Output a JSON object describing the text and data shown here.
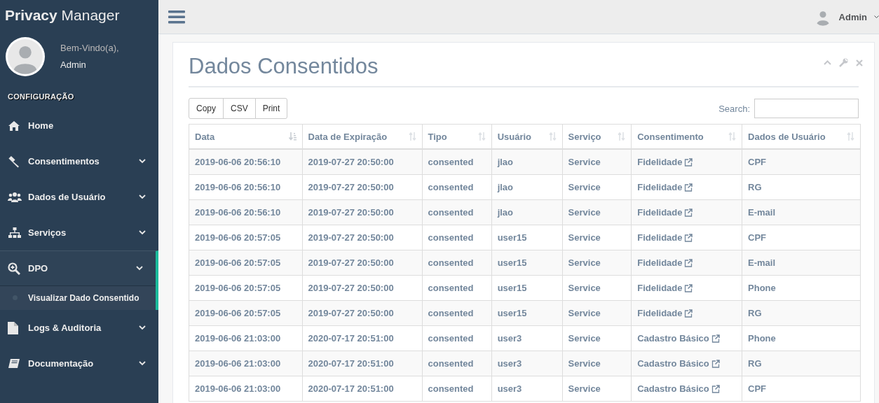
{
  "sidebar": {
    "brand": {
      "bold": "Privacy",
      "rest": "Manager"
    },
    "profile": {
      "greeting": "Bem-Vindo(a),",
      "name": "Admin"
    },
    "section": "CONFIGURAÇÃO",
    "items": [
      {
        "kind": "home",
        "label": "Home",
        "has_submenu": false,
        "expanded": false
      },
      {
        "kind": "gavel",
        "label": "Consentimentos",
        "has_submenu": true,
        "expanded": false
      },
      {
        "kind": "users",
        "label": "Dados de Usuário",
        "has_submenu": true,
        "expanded": false
      },
      {
        "kind": "sitemap",
        "label": "Serviços",
        "has_submenu": true,
        "expanded": false
      },
      {
        "kind": "search",
        "label": "DPO",
        "has_submenu": true,
        "expanded": true,
        "children": [
          {
            "label": "Visualizar Dado Consentido",
            "selected": true
          }
        ]
      },
      {
        "kind": "file",
        "label": "Logs & Auditoria",
        "has_submenu": true,
        "expanded": false
      },
      {
        "kind": "book",
        "label": "Documentação",
        "has_submenu": true,
        "expanded": false
      }
    ]
  },
  "topbar": {
    "user": "Admin"
  },
  "panel": {
    "title": "Dados Consentidos",
    "buttons": [
      "Copy",
      "CSV",
      "Print"
    ],
    "search": {
      "label": "Search:"
    },
    "table": {
      "columns": [
        {
          "label": "Data",
          "sorted": true
        },
        {
          "label": "Data de Expiração",
          "sorted": false
        },
        {
          "label": "Tipo",
          "sorted": false
        },
        {
          "label": "Usuário",
          "sorted": false
        },
        {
          "label": "Serviço",
          "sorted": false
        },
        {
          "label": "Consentimento",
          "sorted": false
        },
        {
          "label": "Dados de Usuário",
          "sorted": false
        }
      ],
      "rows": [
        [
          "2019-06-06 20:56:10",
          "2019-07-27 20:50:00",
          "consented",
          "jlao",
          "Service",
          "Fidelidade",
          "CPF"
        ],
        [
          "2019-06-06 20:56:10",
          "2019-07-27 20:50:00",
          "consented",
          "jlao",
          "Service",
          "Fidelidade",
          "RG"
        ],
        [
          "2019-06-06 20:56:10",
          "2019-07-27 20:50:00",
          "consented",
          "jlao",
          "Service",
          "Fidelidade",
          "E-mail"
        ],
        [
          "2019-06-06 20:57:05",
          "2019-07-27 20:50:00",
          "consented",
          "user15",
          "Service",
          "Fidelidade",
          "CPF"
        ],
        [
          "2019-06-06 20:57:05",
          "2019-07-27 20:50:00",
          "consented",
          "user15",
          "Service",
          "Fidelidade",
          "E-mail"
        ],
        [
          "2019-06-06 20:57:05",
          "2019-07-27 20:50:00",
          "consented",
          "user15",
          "Service",
          "Fidelidade",
          "Phone"
        ],
        [
          "2019-06-06 20:57:05",
          "2019-07-27 20:50:00",
          "consented",
          "user15",
          "Service",
          "Fidelidade",
          "RG"
        ],
        [
          "2019-06-06 21:03:00",
          "2020-07-17 20:51:00",
          "consented",
          "user3",
          "Service",
          "Cadastro Básico",
          "Phone"
        ],
        [
          "2019-06-06 21:03:00",
          "2020-07-17 20:51:00",
          "consented",
          "user3",
          "Service",
          "Cadastro Básico",
          "RG"
        ],
        [
          "2019-06-06 21:03:00",
          "2020-07-17 20:51:00",
          "consented",
          "user3",
          "Service",
          "Cadastro Básico",
          "CPF"
        ]
      ]
    }
  }
}
